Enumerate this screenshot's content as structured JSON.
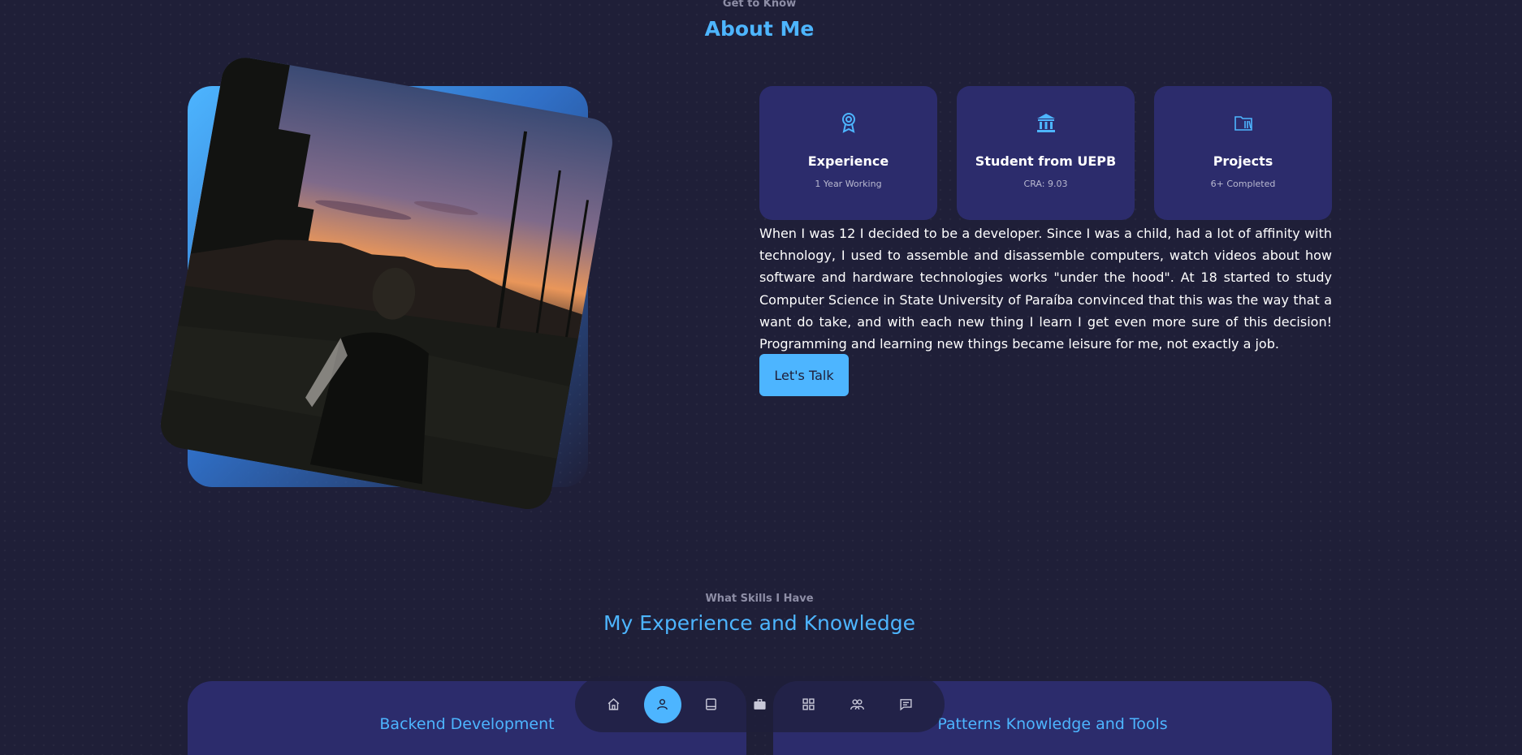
{
  "about": {
    "kicker": "Get to Know",
    "title": "About Me",
    "cards": [
      {
        "icon": "award-icon",
        "title": "Experience",
        "subtitle": "1 Year Working"
      },
      {
        "icon": "bank-icon",
        "title": "Student from UEPB",
        "subtitle": "CRA: 9.03"
      },
      {
        "icon": "folder-icon",
        "title": "Projects",
        "subtitle": "6+ Completed"
      }
    ],
    "bio": "When I was 12 I decided to be a developer. Since I was a child, had a lot of affinity with technology, I used to assemble and disassemble computers, watch videos about how software and hardware technologies works \"under the hood\". At 18 started to study Computer Science in State University of Paraíba convinced that this was the way that a want do take, and with each new thing I learn I get even more sure of this decision! Programming and learning new things became leisure for me, not exactly a job.",
    "cta_label": "Let's Talk"
  },
  "skills": {
    "kicker": "What Skills I Have",
    "title": "My Experience and Knowledge",
    "cards": [
      {
        "title": "Backend Development"
      },
      {
        "title": "Patterns Knowledge and Tools"
      }
    ]
  },
  "nav": {
    "items": [
      {
        "icon": "home-icon",
        "active": false
      },
      {
        "icon": "user-icon",
        "active": true
      },
      {
        "icon": "book-icon",
        "active": false
      },
      {
        "icon": "briefcase-icon",
        "active": false
      },
      {
        "icon": "grid-icon",
        "active": false
      },
      {
        "icon": "users-icon",
        "active": false
      },
      {
        "icon": "message-icon",
        "active": false
      }
    ]
  },
  "colors": {
    "background": "#1f1f38",
    "accent": "#4db5ff",
    "card": "#2c2c6c",
    "text": "#ffffff",
    "muted": "#8e8ea6"
  }
}
